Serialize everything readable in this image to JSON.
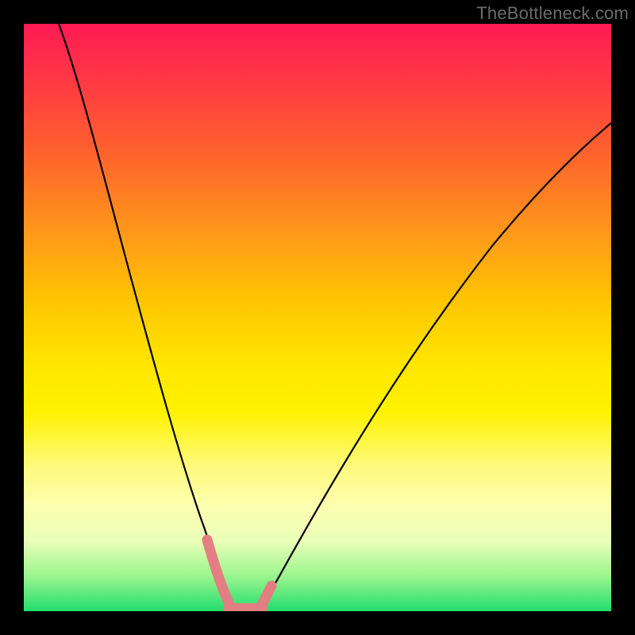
{
  "watermark": "TheBottleneck.com",
  "chart_data": {
    "type": "line",
    "title": "",
    "xlabel": "",
    "ylabel": "",
    "xlim": [
      0,
      100
    ],
    "ylim": [
      0,
      100
    ],
    "grid": false,
    "legend": false,
    "annotations": [],
    "series": [
      {
        "name": "left-curve",
        "stroke": "#000000",
        "x": [
          6,
          10,
          14,
          18,
          22,
          25,
          28,
          30,
          32,
          33.5,
          35.5
        ],
        "y": [
          100,
          88,
          76,
          63,
          50,
          38,
          25,
          16,
          8,
          3,
          0
        ]
      },
      {
        "name": "right-curve",
        "stroke": "#000000",
        "x": [
          40,
          43,
          48,
          54,
          61,
          69,
          78,
          88,
          100
        ],
        "y": [
          0,
          4,
          12,
          24,
          37,
          50,
          62,
          73,
          83
        ]
      },
      {
        "name": "valley-highlight",
        "stroke": "#e37f82",
        "thick": true,
        "x": [
          31,
          32,
          33,
          34,
          35.5,
          38,
          40,
          41,
          42
        ],
        "y": [
          12,
          8,
          4,
          1.5,
          0,
          0,
          0,
          1.5,
          4
        ]
      }
    ],
    "background_gradient_stops": [
      {
        "pos": 0,
        "color": "#ff1a55"
      },
      {
        "pos": 12,
        "color": "#ff4040"
      },
      {
        "pos": 24,
        "color": "#ff6a2a"
      },
      {
        "pos": 36,
        "color": "#ff9a1a"
      },
      {
        "pos": 48,
        "color": "#ffc800"
      },
      {
        "pos": 58,
        "color": "#ffe600"
      },
      {
        "pos": 66,
        "color": "#fff200"
      },
      {
        "pos": 75,
        "color": "#fffa7a"
      },
      {
        "pos": 82,
        "color": "#fdffb0"
      },
      {
        "pos": 88,
        "color": "#eaffb8"
      },
      {
        "pos": 94,
        "color": "#9cf58e"
      },
      {
        "pos": 100,
        "color": "#22dd6e"
      }
    ]
  }
}
